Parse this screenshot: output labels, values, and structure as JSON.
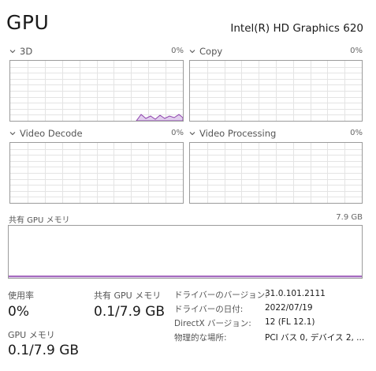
{
  "title": "GPU",
  "device_name": "Intel(R) HD Graphics 620",
  "engines": [
    {
      "label": "3D",
      "percent": "0%"
    },
    {
      "label": "Copy",
      "percent": "0%"
    },
    {
      "label": "Video Decode",
      "percent": "0%"
    },
    {
      "label": "Video Processing",
      "percent": "0%"
    }
  ],
  "shared_memory": {
    "label": "共有 GPU メモリ",
    "max": "7.9 GB"
  },
  "stats": {
    "utilization": {
      "label": "使用率",
      "value": "0%"
    },
    "shared_gpu_memory": {
      "label": "共有 GPU メモリ",
      "value": "0.1/7.9 GB"
    },
    "gpu_memory": {
      "label": "GPU メモリ",
      "value": "0.1/7.9 GB"
    }
  },
  "details": [
    {
      "key": "ドライバーのバージョン:",
      "value": "31.0.101.2111"
    },
    {
      "key": "ドライバーの日付:",
      "value": "2022/07/19"
    },
    {
      "key": "DirectX バージョン:",
      "value": "12 (FL 12.1)"
    },
    {
      "key": "物理的な場所:",
      "value": "PCI バス 0, デバイス 2, ..."
    }
  ],
  "colors": {
    "graph_border": "#9b9b9b",
    "grid": "#e4e4e4",
    "accent": "#8e44ad",
    "fill": "#e2cfee"
  }
}
